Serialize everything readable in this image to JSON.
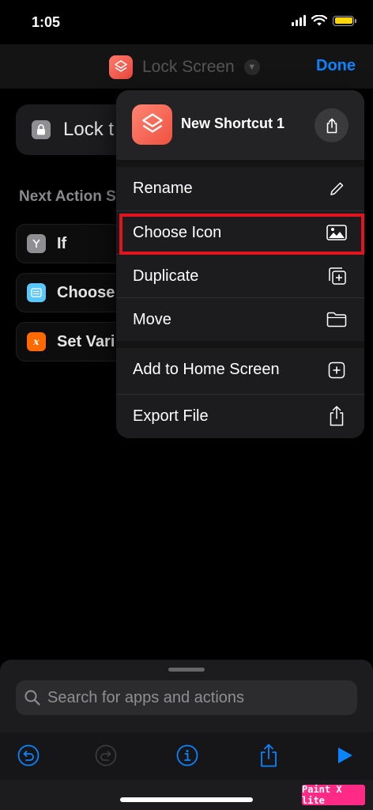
{
  "status_bar": {
    "time": "1:05"
  },
  "nav": {
    "title": "Lock Screen",
    "done_label": "Done"
  },
  "background": {
    "lock_card_text": "Lock t",
    "section_label": "Next Action S",
    "actions": [
      {
        "label": "If",
        "color": "#8e8e93"
      },
      {
        "label": "Choose",
        "color": "#5ac8fa"
      },
      {
        "label": "Set Vari",
        "color": "#ff6a00"
      }
    ]
  },
  "menu": {
    "shortcut_name": "New Shortcut 1",
    "items": [
      {
        "label": "Rename",
        "icon": "pencil-icon"
      },
      {
        "label": "Choose Icon",
        "icon": "photo-icon"
      },
      {
        "label": "Duplicate",
        "icon": "duplicate-icon"
      },
      {
        "label": "Move",
        "icon": "folder-icon"
      },
      {
        "label": "Add to Home Screen",
        "icon": "plus-square-icon"
      },
      {
        "label": "Export File",
        "icon": "share-icon"
      }
    ]
  },
  "search": {
    "placeholder": "Search for apps and actions"
  },
  "watermark": "Paint X lite",
  "colors": {
    "accent": "#0a84ff",
    "highlight": "#e0141e",
    "shortcut_icon": "#ef5140"
  }
}
